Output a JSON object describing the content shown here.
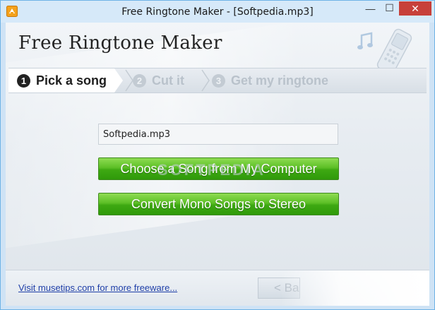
{
  "window": {
    "title": "Free Ringtone Maker - [Softpedia.mp3]",
    "minimize_glyph": "—",
    "maximize_glyph": "☐",
    "close_glyph": "✕"
  },
  "header": {
    "app_name": "Free Ringtone Maker"
  },
  "steps": [
    {
      "number": "1",
      "label": "Pick a song",
      "active": true
    },
    {
      "number": "2",
      "label": "Cut it",
      "active": false
    },
    {
      "number": "3",
      "label": "Get my ringtone",
      "active": false
    }
  ],
  "main": {
    "file_value": "Softpedia.mp3",
    "choose_button_label": "Choose a Song from My Computer",
    "convert_button_label": "Convert Mono Songs to Stereo",
    "watermark": "SOFTPEDIA"
  },
  "footer": {
    "link_text": "Visit musetips.com for more freeware...",
    "back_button_label": "< Ba"
  },
  "colors": {
    "accent_green": "#4cb41c",
    "link_blue": "#1f3fa8",
    "close_red": "#c7403a"
  },
  "icons": [
    "app-icon",
    "music-note-icon",
    "phone-icon",
    "step-arrow-icon"
  ]
}
